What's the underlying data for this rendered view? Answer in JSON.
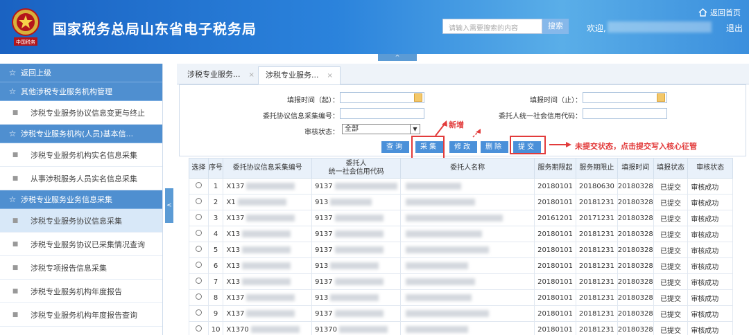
{
  "header": {
    "title": "国家税务总局山东省电子税务局",
    "logo_text": "中国税务",
    "search_placeholder": "请输入需要搜索的内容",
    "search_button": "搜索",
    "welcome": "欢迎,",
    "home_link": "返回首页",
    "logout": "退出",
    "collapse_symbol": "^"
  },
  "sidebar": {
    "items": [
      {
        "type": "head",
        "label": "返回上级"
      },
      {
        "type": "head",
        "label": "其他涉税专业服务机构管理"
      },
      {
        "type": "sub",
        "label": "涉税专业服务协议信息变更与终止"
      },
      {
        "type": "head",
        "label": "涉税专业服务机构(人员)基本信..."
      },
      {
        "type": "sub",
        "label": "涉税专业服务机构实名信息采集"
      },
      {
        "type": "sub",
        "label": "从事涉税服务人员实名信息采集"
      },
      {
        "type": "head",
        "label": "涉税专业服务业务信息采集"
      },
      {
        "type": "sub",
        "label": "涉税专业服务协议信息采集",
        "active": true
      },
      {
        "type": "sub",
        "label": "涉税专业服务协议已采集情况查询"
      },
      {
        "type": "sub",
        "label": "涉税专项报告信息采集"
      },
      {
        "type": "sub",
        "label": "涉税专业服务机构年度报告"
      },
      {
        "type": "sub",
        "label": "涉税专业服务机构年度报告查询"
      }
    ],
    "toggle_symbol": "<"
  },
  "tabs": [
    {
      "label": "涉税专业服务...",
      "close": "×"
    },
    {
      "label": "涉税专业服务...",
      "close": "×"
    }
  ],
  "form": {
    "fill_start_label": "填报时间（起）：",
    "fill_end_label": "填报时间（止）：",
    "agreement_no_label": "委托协议信息采集编号：",
    "credit_code_label": "委托人统一社会信用代码：",
    "review_status_label": "审核状态：",
    "review_status_value": "全部",
    "buttons": {
      "query": "查询",
      "collect": "采集",
      "modify": "修改",
      "delete": "删除",
      "submit": "提交"
    }
  },
  "annotations": {
    "new": "新增",
    "submit_note": "未提交状态，点击提交写入核心征管"
  },
  "table": {
    "headers": [
      "选择",
      "序号",
      "委托协议信息采集编号",
      "委托人\n统一社会信用代码",
      "委托人名称",
      "服务期限起",
      "服务期限止",
      "填报时间",
      "填报状态",
      "审核状态"
    ],
    "rows": [
      {
        "no": "1",
        "code": "X137",
        "credit": "9137",
        "start": "20180101",
        "end": "20180630",
        "fill": "20180328",
        "fstatus": "已提交",
        "rstatus": "审核成功"
      },
      {
        "no": "2",
        "code": "X1",
        "credit": "913",
        "start": "20180101",
        "end": "20181231",
        "fill": "20180328",
        "fstatus": "已提交",
        "rstatus": "审核成功"
      },
      {
        "no": "3",
        "code": "X137",
        "credit": "9137",
        "start": "20161201",
        "end": "20171231",
        "fill": "20180328",
        "fstatus": "已提交",
        "rstatus": "审核成功"
      },
      {
        "no": "4",
        "code": "X13",
        "credit": "9137",
        "start": "20180101",
        "end": "20181231",
        "fill": "20180328",
        "fstatus": "已提交",
        "rstatus": "审核成功"
      },
      {
        "no": "5",
        "code": "X13",
        "credit": "9137",
        "start": "20180101",
        "end": "20181231",
        "fill": "20180328",
        "fstatus": "已提交",
        "rstatus": "审核成功"
      },
      {
        "no": "6",
        "code": "X13",
        "credit": "913",
        "start": "20180101",
        "end": "20181231",
        "fill": "20180328",
        "fstatus": "已提交",
        "rstatus": "审核成功"
      },
      {
        "no": "7",
        "code": "X13",
        "credit": "9137",
        "start": "20180101",
        "end": "20181231",
        "fill": "20180328",
        "fstatus": "已提交",
        "rstatus": "审核成功"
      },
      {
        "no": "8",
        "code": "X137",
        "credit": "913",
        "start": "20180101",
        "end": "20181231",
        "fill": "20180328",
        "fstatus": "已提交",
        "rstatus": "审核成功"
      },
      {
        "no": "9",
        "code": "X137",
        "credit": "9137",
        "start": "20180101",
        "end": "20181231",
        "fill": "20180328",
        "fstatus": "已提交",
        "rstatus": "审核成功"
      },
      {
        "no": "10",
        "code": "X1370",
        "credit": "91370",
        "start": "20180101",
        "end": "20181231",
        "fill": "20180328",
        "fstatus": "已提交",
        "rstatus": "审核成功"
      }
    ]
  },
  "colors": {
    "accent": "#4a90d9",
    "annotation": "#e23b3b",
    "header": "#2b83dc"
  }
}
